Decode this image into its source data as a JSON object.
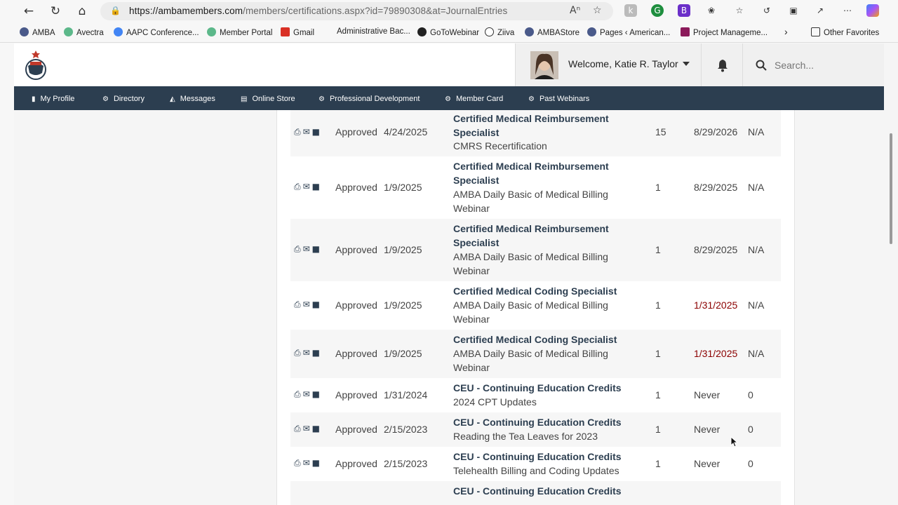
{
  "browser": {
    "url_host": "https://ambamembers.com",
    "url_path": "/members/certifications.aspx?id=79890308&at=JournalEntries",
    "bookmarks": [
      "AMBA",
      "Avectra",
      "AAPC Conference...",
      "Member Portal",
      "Gmail",
      "Administrative Bac...",
      "GoToWebinar",
      "Ziiva",
      "AMBAStore",
      "Pages ‹ American...",
      "Project Manageme...",
      "Other Favorites"
    ]
  },
  "header": {
    "welcome": "Welcome, Katie R. Taylor",
    "search_placeholder": "Search..."
  },
  "nav": [
    "My Profile",
    "Directory",
    "Messages",
    "Online Store",
    "Professional Development",
    "Member Card",
    "Past Webinars"
  ],
  "journal": {
    "rows": [
      {
        "status": "Approved",
        "date": "4/24/2025",
        "title1": "Certified Medical Reimbursement",
        "title2": "Specialist",
        "desc1": "CMRS Recertification",
        "desc2": "",
        "credits": "15",
        "expires": "8/29/2026",
        "extra": "N/A"
      },
      {
        "status": "Approved",
        "date": "1/9/2025",
        "title1": "Certified Medical Reimbursement",
        "title2": "Specialist",
        "desc1": "AMBA Daily Basic of Medical Billing",
        "desc2": "Webinar",
        "credits": "1",
        "expires": "8/29/2025",
        "extra": "N/A"
      },
      {
        "status": "Approved",
        "date": "1/9/2025",
        "title1": "Certified Medical Reimbursement",
        "title2": "Specialist",
        "desc1": "AMBA Daily Basic of Medical Billing",
        "desc2": "Webinar",
        "credits": "1",
        "expires": "8/29/2025",
        "extra": "N/A"
      },
      {
        "status": "Approved",
        "date": "1/9/2025",
        "title1": "Certified Medical Coding Specialist",
        "title2": "",
        "desc1": "AMBA Daily Basic of Medical Billing",
        "desc2": "Webinar",
        "credits": "1",
        "expires": "1/31/2025",
        "extra": "N/A"
      },
      {
        "status": "Approved",
        "date": "1/9/2025",
        "title1": "Certified Medical Coding Specialist",
        "title2": "",
        "desc1": "AMBA Daily Basic of Medical Billing",
        "desc2": "Webinar",
        "credits": "1",
        "expires": "1/31/2025",
        "extra": "N/A"
      },
      {
        "status": "Approved",
        "date": "1/31/2024",
        "title1": "CEU - Continuing Education Credits",
        "title2": "",
        "desc1": "2024 CPT Updates",
        "desc2": "",
        "credits": "1",
        "expires": "Never",
        "extra": "0"
      },
      {
        "status": "Approved",
        "date": "2/15/2023",
        "title1": "CEU - Continuing Education Credits",
        "title2": "",
        "desc1": "Reading the Tea Leaves for 2023",
        "desc2": "",
        "credits": "1",
        "expires": "Never",
        "extra": "0"
      },
      {
        "status": "Approved",
        "date": "2/15/2023",
        "title1": "CEU - Continuing Education Credits",
        "title2": "",
        "desc1": "Telehealth Billing and Coding Updates",
        "desc2": "",
        "credits": "1",
        "expires": "Never",
        "extra": "0"
      },
      {
        "status": "",
        "date": "",
        "title1": "CEU - Continuing Education Credits",
        "title2": "",
        "desc1": "",
        "desc2": "",
        "credits": "",
        "expires": "",
        "extra": ""
      }
    ]
  },
  "colors": {
    "nav_bg": "#2c3e50",
    "title": "#2c3e50",
    "expired": "#8b0000"
  }
}
